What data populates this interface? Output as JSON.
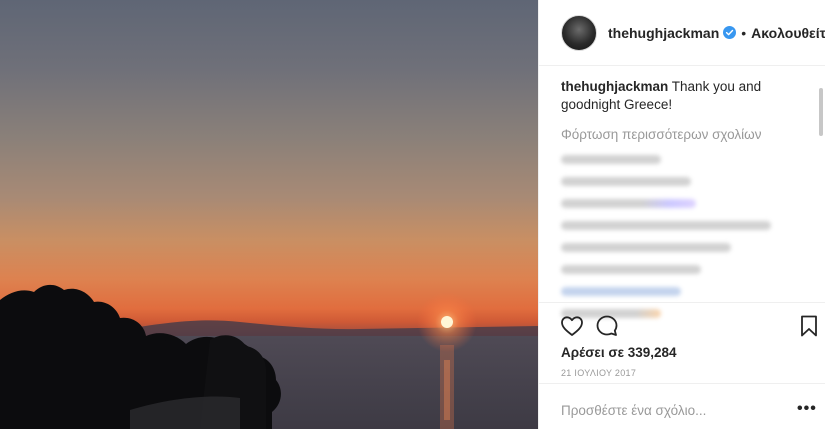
{
  "post": {
    "author": {
      "username": "thehughjackman",
      "verified": true,
      "separator": "•",
      "follow_label": "Ακολουθείτε"
    },
    "caption": {
      "username": "thehughjackman",
      "text": "Thank you and goodnight Greece!"
    },
    "load_more_label": "Φόρτωση περισσότερων σχολίων",
    "likes_text": "Αρέσει σε 339,284",
    "date": "21 ΙΟΥΛΙΟΥ 2017",
    "comment_placeholder": "Προσθέστε ένα σχόλιο...",
    "more_options_label": "•••"
  }
}
